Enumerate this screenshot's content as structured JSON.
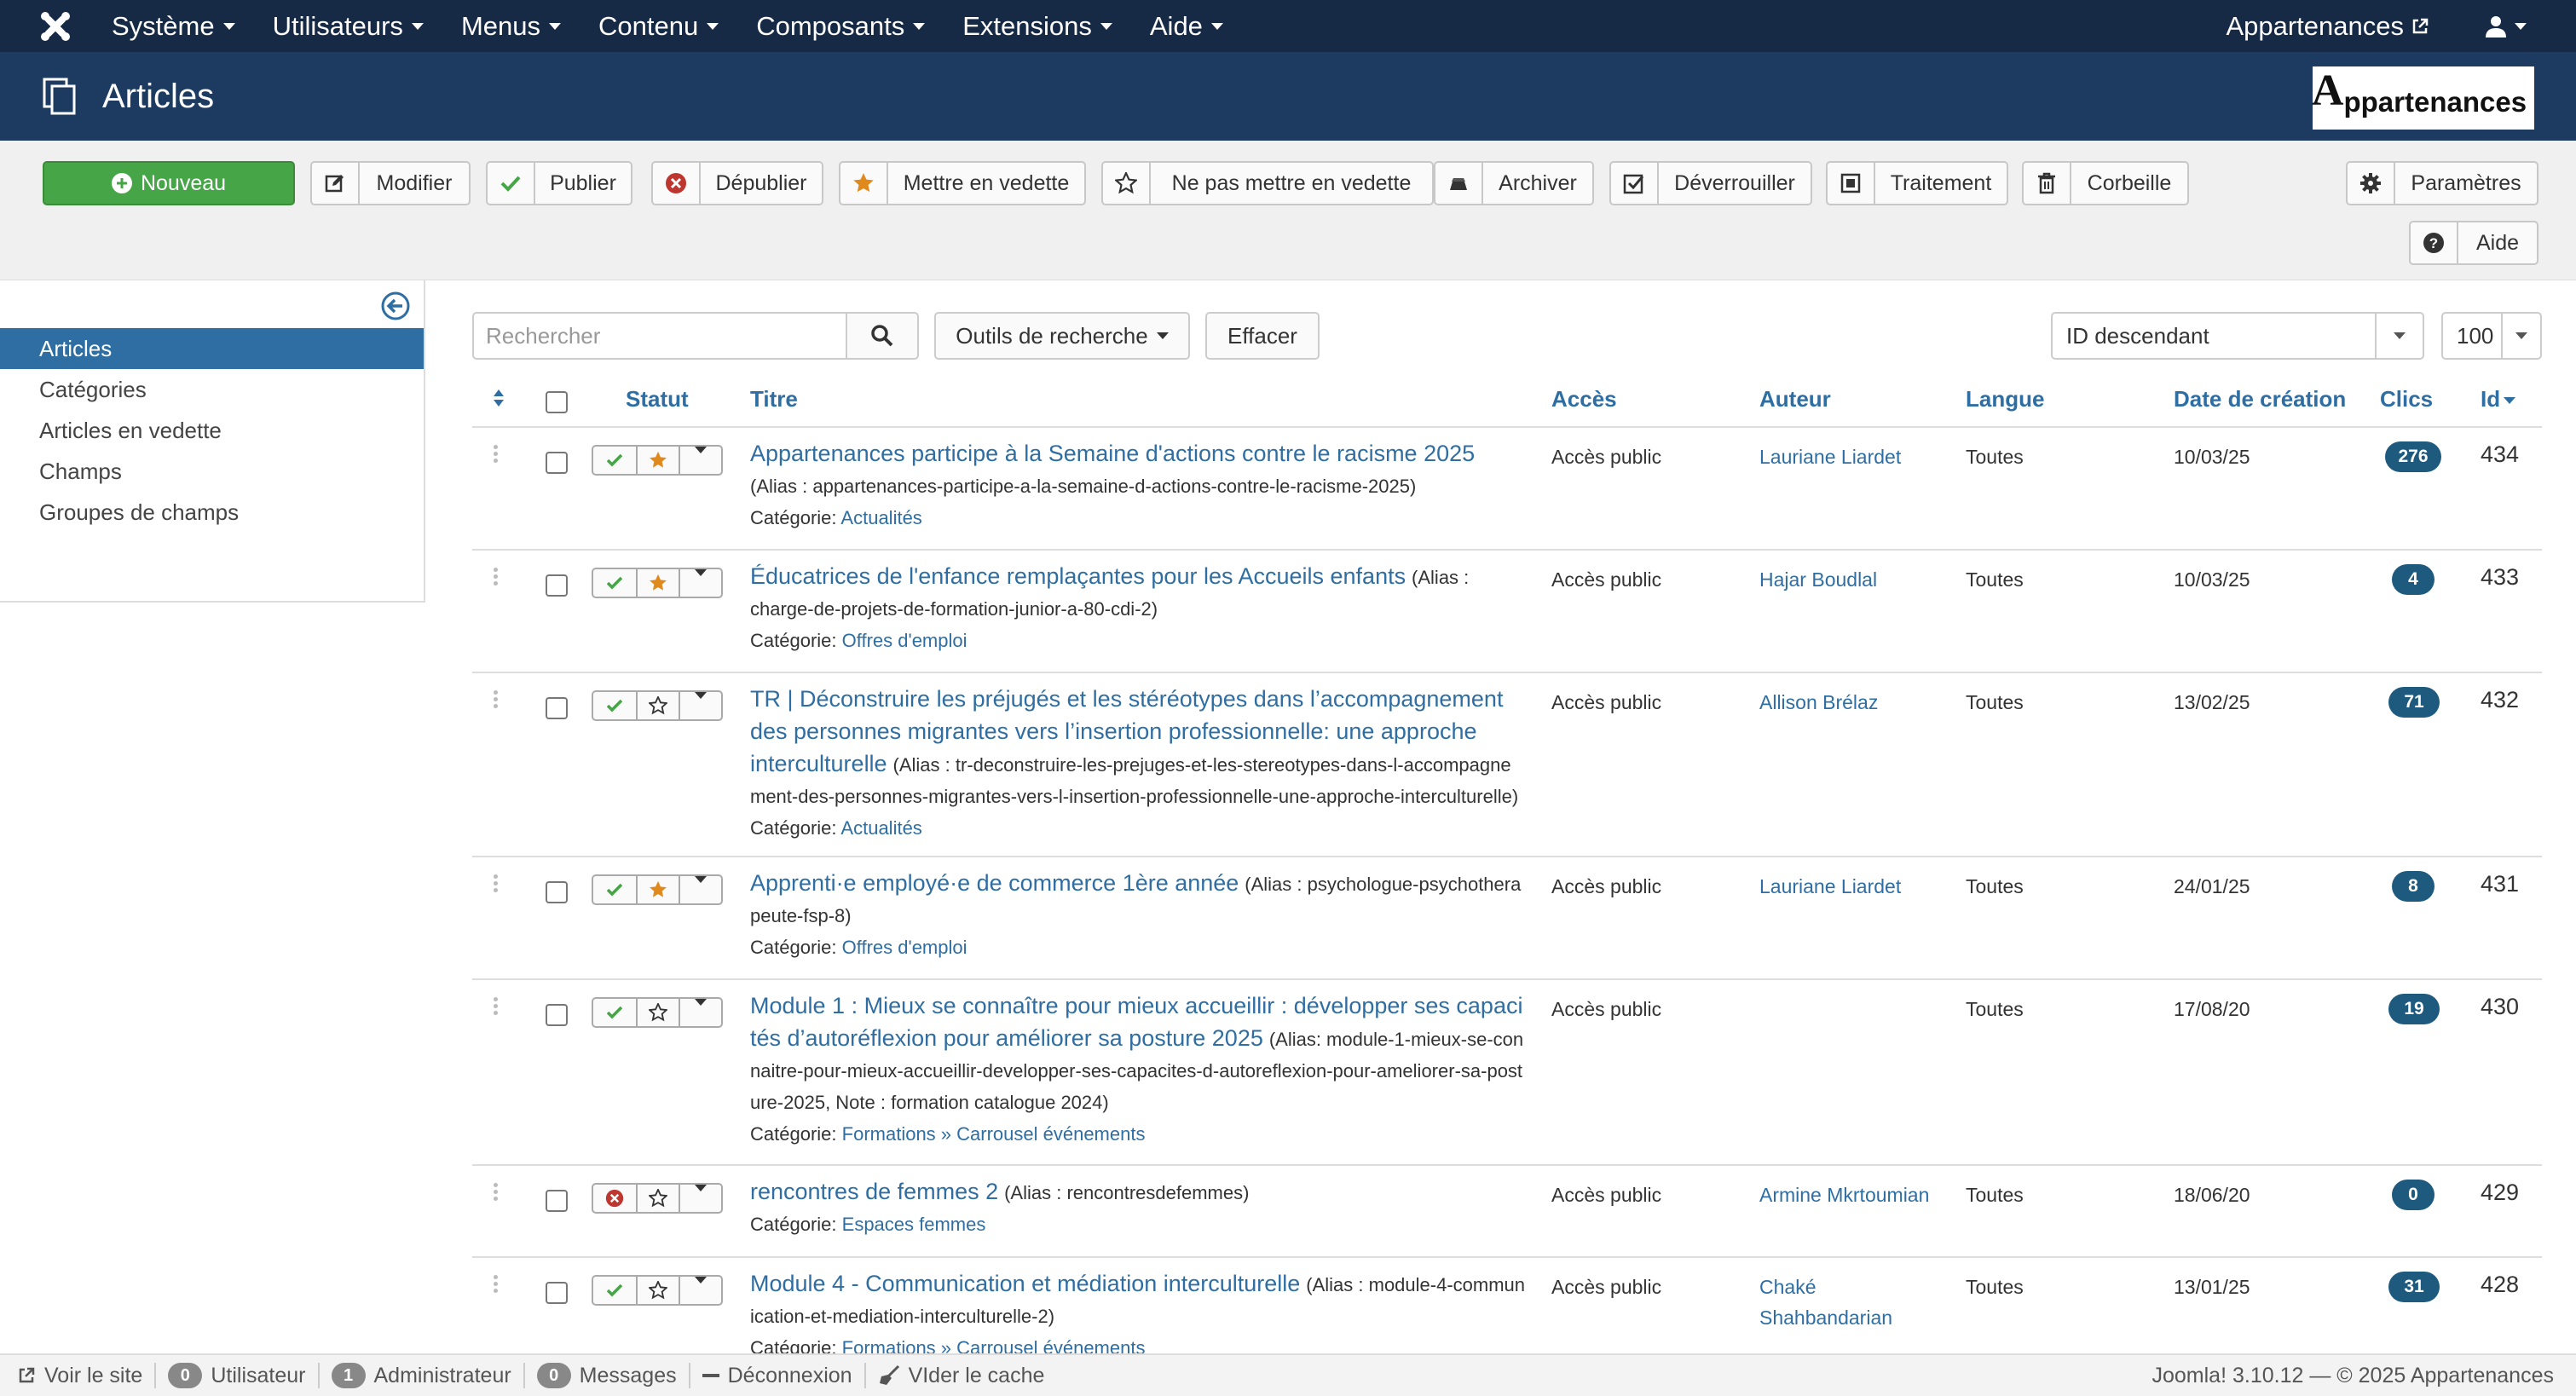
{
  "navbar": {
    "menus": [
      {
        "label": "Système"
      },
      {
        "label": "Utilisateurs"
      },
      {
        "label": "Menus"
      },
      {
        "label": "Contenu"
      },
      {
        "label": "Composants"
      },
      {
        "label": "Extensions"
      },
      {
        "label": "Aide"
      }
    ],
    "site_link": "Appartenances"
  },
  "header": {
    "title": "Articles",
    "brand_letter": "A",
    "brand_text": "ppartenances"
  },
  "toolbar": {
    "new": "Nouveau",
    "edit": "Modifier",
    "publish": "Publier",
    "unpublish": "Dépublier",
    "feature": "Mettre en vedette",
    "unfeature": "Ne pas mettre en vedette",
    "archive": "Archiver",
    "checkin": "Déverrouiller",
    "batch": "Traitement",
    "trash": "Corbeille",
    "options": "Paramètres",
    "help": "Aide"
  },
  "sidebar": {
    "items": [
      {
        "label": "Articles",
        "active": true
      },
      {
        "label": "Catégories"
      },
      {
        "label": "Articles en vedette"
      },
      {
        "label": "Champs"
      },
      {
        "label": "Groupes de champs"
      }
    ]
  },
  "filters": {
    "search_placeholder": "Rechercher",
    "search_tools": "Outils de recherche",
    "clear": "Effacer",
    "ordering": "ID descendant",
    "limit": "100"
  },
  "table": {
    "headers": {
      "status": "Statut",
      "title": "Titre",
      "access": "Accès",
      "author": "Auteur",
      "language": "Langue",
      "date": "Date de création",
      "hits": "Clics",
      "id": "Id"
    },
    "category_label": "Catégorie:",
    "rows": [
      {
        "title": "Appartenances participe à la Semaine d'actions contre le racisme 2025",
        "alias": "(Alias : appartenances-participe-a-la-semaine-d-actions-contre-le-racisme-2025)",
        "category": "Actualités",
        "published": true,
        "featured": true,
        "access": "Accès public",
        "author": "Lauriane Liardet",
        "language": "Toutes",
        "date": "10/03/25",
        "hits": "276",
        "id": "434"
      },
      {
        "title": "Éducatrices de l'enfance remplaçantes pour les Accueils enfants",
        "alias": "(Alias : charge-de-projets-de-formation-junior-a-80-cdi-2)",
        "category": "Offres d'emploi",
        "published": true,
        "featured": true,
        "access": "Accès public",
        "author": "Hajar Boudlal",
        "language": "Toutes",
        "date": "10/03/25",
        "hits": "4",
        "id": "433"
      },
      {
        "title": "TR | Déconstruire les préjugés et les stéréotypes dans l’accompagnement des personnes migrantes vers l’insertion professionnelle: une approche interculturelle",
        "alias": "(Alias : tr-deconstruire-les-prejuges-et-les-stereotypes-dans-l-accompagnement-des-personnes-migrantes-vers-l-insertion-professionnelle-une-approche-interculturelle)",
        "category": "Actualités",
        "published": true,
        "featured": false,
        "access": "Accès public",
        "author": "Allison Brélaz",
        "language": "Toutes",
        "date": "13/02/25",
        "hits": "71",
        "id": "432"
      },
      {
        "title": "Apprenti·e employé·e de commerce 1ère année",
        "alias": "(Alias : psychologue-psychotherapeute-fsp-8)",
        "category": "Offres d'emploi",
        "published": true,
        "featured": true,
        "access": "Accès public",
        "author": "Lauriane Liardet",
        "language": "Toutes",
        "date": "24/01/25",
        "hits": "8",
        "id": "431"
      },
      {
        "title": "Module 1 : Mieux se connaître pour mieux accueillir : développer ses capacités d’autoréflexion pour améliorer sa posture 2025",
        "alias": "(Alias: module-1-mieux-se-connaitre-pour-mieux-accueillir-developper-ses-capacites-d-autoreflexion-pour-ameliorer-sa-posture-2025, Note : formation catalogue 2024)",
        "category": "Formations » Carrousel événements",
        "published": true,
        "featured": false,
        "access": "Accès public",
        "author": "",
        "language": "Toutes",
        "date": "17/08/20",
        "hits": "19",
        "id": "430"
      },
      {
        "title": "rencontres de femmes 2",
        "alias": "(Alias : rencontresdefemmes)",
        "category": "Espaces femmes",
        "published": false,
        "featured": false,
        "access": "Accès public",
        "author": "Armine Mkrtoumian",
        "language": "Toutes",
        "date": "18/06/20",
        "hits": "0",
        "id": "429"
      },
      {
        "title": "Module 4 - Communication et médiation interculturelle",
        "alias": "(Alias : module-4-communication-et-mediation-interculturelle-2)",
        "category": "Formations » Carrousel événements",
        "published": true,
        "featured": false,
        "access": "Accès public",
        "author": "Chaké Shahbandarian",
        "language": "Toutes",
        "date": "13/01/25",
        "hits": "31",
        "id": "428"
      }
    ]
  },
  "statusbar": {
    "view_site": "Voir le site",
    "users_count": "0",
    "users_label": "Utilisateur",
    "admins_count": "1",
    "admins_label": "Administrateur",
    "messages_count": "0",
    "messages_label": "Messages",
    "logout": "Déconnexion",
    "clear_cache": "VIder le cache",
    "version": "Joomla! 3.10.12  —  © 2025 Appartenances"
  },
  "colors": {
    "navbar": "#172a45",
    "header": "#1d3b61",
    "link": "#2f6ea3",
    "new_button": "#46a546",
    "publish_check": "#46a546",
    "unpublish_x": "#bd362f",
    "featured_star": "#e08a1e",
    "hits_badge": "#1d5a7e"
  }
}
